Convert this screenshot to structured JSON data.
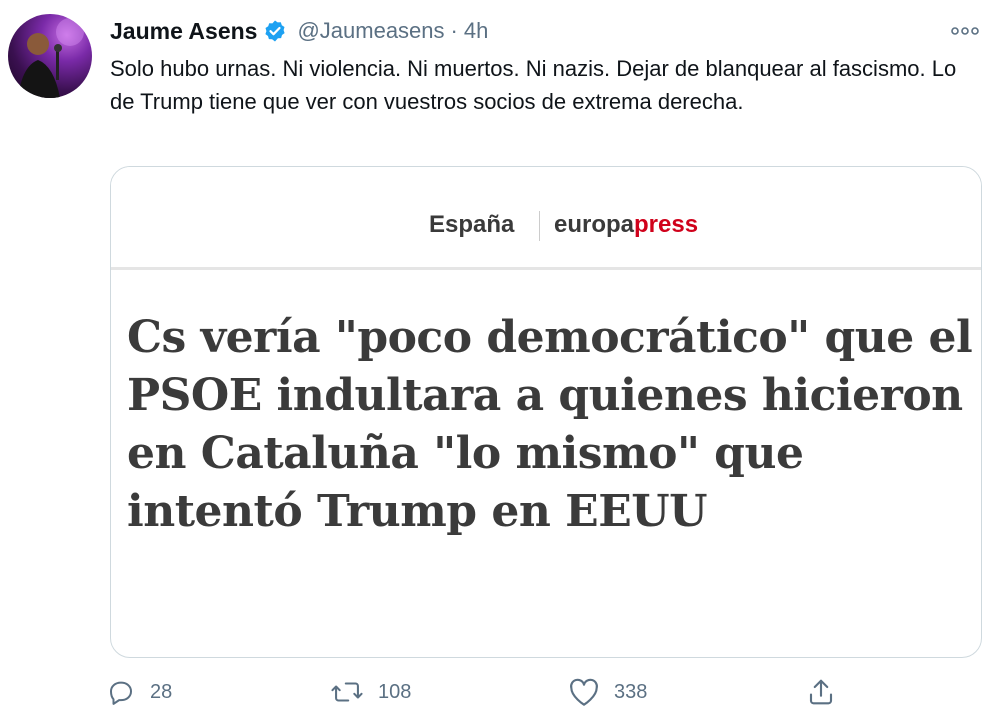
{
  "tweet": {
    "display_name": "Jaume Asens",
    "handle": "@Jaumeasens",
    "separator": "·",
    "time": "4h",
    "text": "Solo hubo urnas. Ni violencia. Ni muertos. Ni nazis. Dejar de blanquear al fascismo. Lo de Trump tiene que ver con vuestros socios de extrema derecha."
  },
  "card": {
    "section": "España",
    "brand_part1": "europa",
    "brand_part2": "press",
    "headline": "Cs vería \"poco democrático\" que el PSOE indultara a quienes hicieron en Cataluña \"lo mismo\" que intentó Trump en EEUU"
  },
  "actions": {
    "reply_count": "28",
    "retweet_count": "108",
    "like_count": "338"
  },
  "colors": {
    "verified": "#1da1f2",
    "muted": "#5b7083",
    "brand_red": "#d0011b"
  }
}
